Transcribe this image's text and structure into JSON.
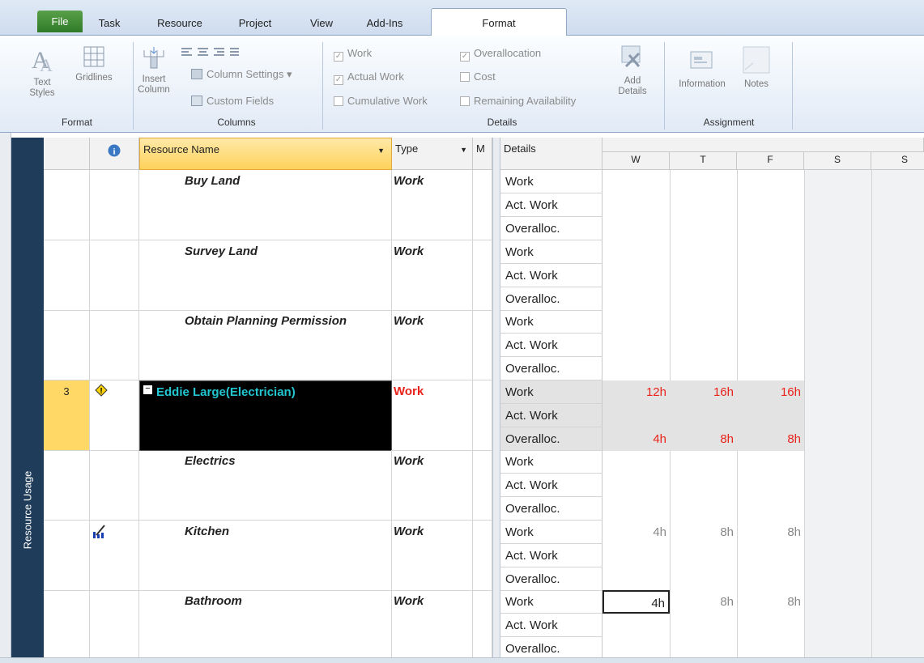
{
  "tabs": {
    "file": "File",
    "task": "Task",
    "resource": "Resource",
    "project": "Project",
    "view": "View",
    "addins": "Add-Ins",
    "format": "Format"
  },
  "ribbon": {
    "text_styles": "Text Styles",
    "gridlines": "Gridlines",
    "insert_column": "Insert Column",
    "column_settings": "Column Settings",
    "custom_fields": "Custom Fields",
    "work": "Work",
    "actual_work": "Actual Work",
    "cumulative_work": "Cumulative Work",
    "overallocation": "Overallocation",
    "cost": "Cost",
    "remaining_availability": "Remaining Availability",
    "add_details": "Add Details",
    "information": "Information",
    "notes": "Notes",
    "group_format": "Format",
    "group_columns": "Columns",
    "group_details": "Details",
    "group_assignment": "Assignment"
  },
  "sidebar": {
    "view_label": "Resource Usage"
  },
  "grid": {
    "header_name": "Resource Name",
    "header_type": "Type",
    "header_m": "M",
    "header_details": "Details",
    "days": [
      "W",
      "T",
      "F",
      "S",
      "S"
    ]
  },
  "rows": [
    {
      "id": "",
      "name": "Buy Land",
      "type": "Work",
      "indicator": "",
      "details": [
        "Work",
        "Act. Work",
        "Overalloc."
      ],
      "values": [
        [
          "",
          "",
          ""
        ],
        [
          "",
          "",
          ""
        ],
        [
          "",
          "",
          ""
        ]
      ]
    },
    {
      "id": "",
      "name": "Survey Land",
      "type": "Work",
      "indicator": "",
      "details": [
        "Work",
        "Act. Work",
        "Overalloc."
      ],
      "values": [
        [
          "",
          "",
          ""
        ],
        [
          "",
          "",
          ""
        ],
        [
          "",
          "",
          ""
        ]
      ]
    },
    {
      "id": "",
      "name": "Obtain Planning Permission",
      "type": "Work",
      "indicator": "",
      "details": [
        "Work",
        "Act. Work",
        "Overalloc."
      ],
      "values": [
        [
          "",
          "",
          ""
        ],
        [
          "",
          "",
          ""
        ],
        [
          "",
          "",
          ""
        ]
      ]
    },
    {
      "id": "3",
      "name": "Eddie Large(Electrician)",
      "type": "Work",
      "indicator": "warning",
      "details": [
        "Work",
        "Act. Work",
        "Overalloc."
      ],
      "values": [
        [
          "12h",
          "16h",
          "16h"
        ],
        [
          "",
          "",
          ""
        ],
        [
          "4h",
          "8h",
          "8h"
        ]
      ]
    },
    {
      "id": "",
      "name": "Electrics",
      "type": "Work",
      "indicator": "",
      "details": [
        "Work",
        "Act. Work",
        "Overalloc."
      ],
      "values": [
        [
          "",
          "",
          ""
        ],
        [
          "",
          "",
          ""
        ],
        [
          "",
          "",
          ""
        ]
      ]
    },
    {
      "id": "",
      "name": "Kitchen",
      "type": "Work",
      "indicator": "assignment-edit",
      "details": [
        "Work",
        "Act. Work",
        "Overalloc."
      ],
      "values": [
        [
          "4h",
          "8h",
          "8h"
        ],
        [
          "",
          "",
          ""
        ],
        [
          "",
          "",
          ""
        ]
      ]
    },
    {
      "id": "",
      "name": "Bathroom",
      "type": "Work",
      "indicator": "",
      "details": [
        "Work",
        "Act. Work",
        "Overalloc."
      ],
      "values": [
        [
          "4h",
          "8h",
          "8h"
        ],
        [
          "",
          "",
          ""
        ],
        [
          "",
          "",
          ""
        ]
      ]
    }
  ],
  "colors": {
    "overalloc_red": "#e8231b",
    "resource_cyan": "#21c6d0",
    "selected_row": "#ffd866",
    "sidebar": "#1f3c5a"
  }
}
